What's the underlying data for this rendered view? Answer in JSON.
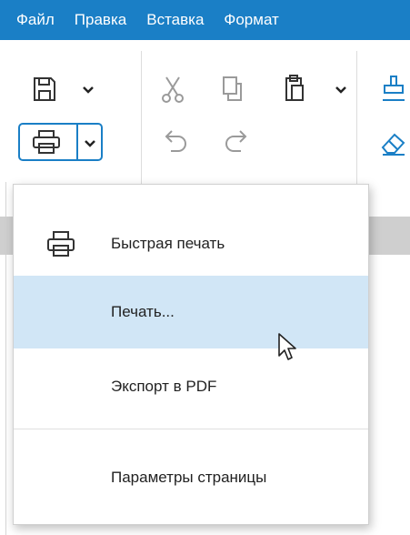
{
  "menubar": {
    "items": [
      "Файл",
      "Правка",
      "Вставка",
      "Формат"
    ]
  },
  "toolbar": {
    "icons": [
      "save-icon",
      "print-icon",
      "cut-icon",
      "copy-icon",
      "paste-icon",
      "undo-icon",
      "redo-icon",
      "format-painter-icon",
      "eraser-icon"
    ]
  },
  "print_menu": {
    "items": [
      {
        "label": "Быстрая печать",
        "icon": "printer-icon"
      },
      {
        "label": "Печать...",
        "highlighted": true
      },
      {
        "label": "Экспорт в PDF"
      },
      {
        "label": "Параметры страницы"
      }
    ]
  },
  "colors": {
    "accent": "#1a7fc6",
    "highlight": "#d1e6f6"
  }
}
